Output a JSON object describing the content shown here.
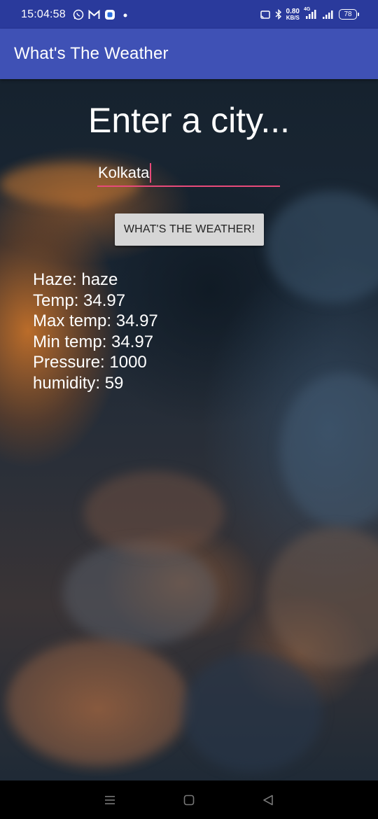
{
  "status_bar": {
    "time": "15:04:58",
    "net_speed_value": "0.80",
    "net_speed_unit": "KB/S",
    "network_type": "4G",
    "battery_level": "78"
  },
  "app_bar": {
    "title": "What's The Weather"
  },
  "main": {
    "heading": "Enter a city...",
    "city_input_value": "Kolkata",
    "button_label": "WHAT'S THE WEATHER!",
    "results": [
      "Haze: haze",
      "Temp: 34.97",
      "Max temp: 34.97",
      "Min temp: 34.97",
      "Pressure: 1000",
      "humidity: 59"
    ]
  },
  "nav_bar": {
    "icons": [
      "menu-icon",
      "home-icon",
      "back-icon"
    ]
  },
  "colors": {
    "status_bar": "#2a3a9c",
    "app_bar": "#3f51b5",
    "accent": "#e84a7a",
    "button_bg": "#d6d6d6"
  }
}
